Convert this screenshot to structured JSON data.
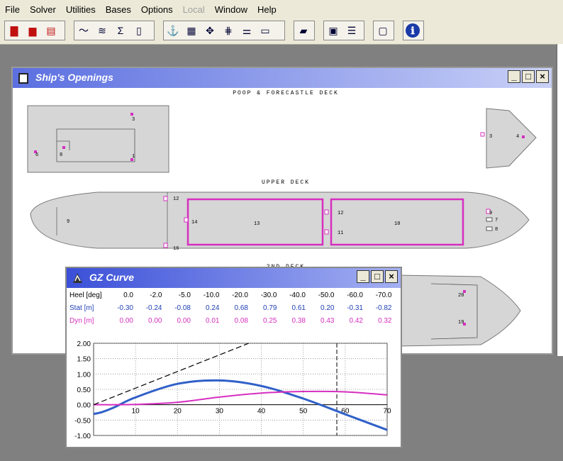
{
  "menu": [
    "File",
    "Solver",
    "Utilities",
    "Bases",
    "Options",
    "Local",
    "Window",
    "Help"
  ],
  "menu_disabled": [
    "Local"
  ],
  "toolbar_icons": [
    "new-file-icon",
    "open-file-icon",
    "print-icon",
    "curve-icon",
    "waterline-icon",
    "sigma-icon",
    "tank-icon",
    "stability-icon",
    "calculator-doc-icon",
    "mast-icon",
    "rig-icon",
    "gun-icon",
    "hull-section-icon",
    "book-icon",
    "device-icon",
    "list-icon",
    "window-icon",
    "info-icon"
  ],
  "openings_window": {
    "title": "Ship's Openings",
    "deck1": "POOP & FORECASTLE DECK",
    "deck2": "UPPER DECK",
    "deck3": "2ND DECK",
    "labels": {
      "poop_a": "3",
      "poop_b": "1",
      "poop_c": "6",
      "poop_d": "8",
      "fcle_a": "3",
      "fcle_b": "4",
      "ud_aft": "9",
      "ud_12": "12",
      "ud_13": "13",
      "ud_14": "14",
      "ud_10": "10",
      "ud_12b": "12",
      "ud_11": "11",
      "ud_15": "15",
      "ud_16": "16",
      "ud_fore_a": "9",
      "ud_fore_b": "7",
      "ud_fore_c": "8",
      "sd_a": "20",
      "sd_b": "19"
    }
  },
  "gz_window": {
    "title": "GZ Curve",
    "rows": [
      {
        "label": "Heel [deg]",
        "color": "#000000",
        "values": [
          "0.0",
          "-2.0",
          "-5.0",
          "-10.0",
          "-20.0",
          "-30.0",
          "-40.0",
          "-50.0",
          "-60.0",
          "-70.0"
        ]
      },
      {
        "label": "Stat [m]",
        "color": "#1f3fb4",
        "values": [
          "-0.30",
          "-0.24",
          "-0.08",
          "0.24",
          "0.68",
          "0.79",
          "0.61",
          "0.20",
          "-0.31",
          "-0.82"
        ]
      },
      {
        "label": "Dyn [m]",
        "color": "#d62fc0",
        "values": [
          "0.00",
          "0.00",
          "0.00",
          "0.01",
          "0.08",
          "0.25",
          "0.38",
          "0.43",
          "0.42",
          "0.32"
        ]
      }
    ]
  },
  "chart_data": {
    "type": "line",
    "xlim": [
      0,
      70
    ],
    "ylim": [
      -1.0,
      2.0
    ],
    "x_ticks": [
      10,
      20,
      30,
      40,
      50,
      60,
      70
    ],
    "y_ticks": [
      "2.00",
      "1.50",
      "1.00",
      "0.50",
      "0.00",
      "-0.50",
      "-1.00"
    ],
    "grid": true,
    "series": [
      {
        "color": "#3060c8",
        "x": [
          0,
          2,
          5,
          10,
          20,
          30,
          40,
          50,
          60,
          70
        ],
        "y": [
          -0.3,
          -0.24,
          -0.08,
          0.24,
          0.68,
          0.79,
          0.61,
          0.2,
          -0.31,
          -0.82
        ]
      },
      {
        "color": "#d62fc0",
        "x": [
          0,
          2,
          5,
          10,
          20,
          30,
          40,
          50,
          60,
          70
        ],
        "y": [
          0.0,
          0.0,
          0.0,
          0.01,
          0.08,
          0.25,
          0.38,
          0.43,
          0.42,
          0.32
        ]
      },
      {
        "color": "#000000",
        "dashed": true,
        "x": [
          0,
          37
        ],
        "y": [
          0.0,
          2.0
        ]
      }
    ],
    "vline_x": 58
  }
}
